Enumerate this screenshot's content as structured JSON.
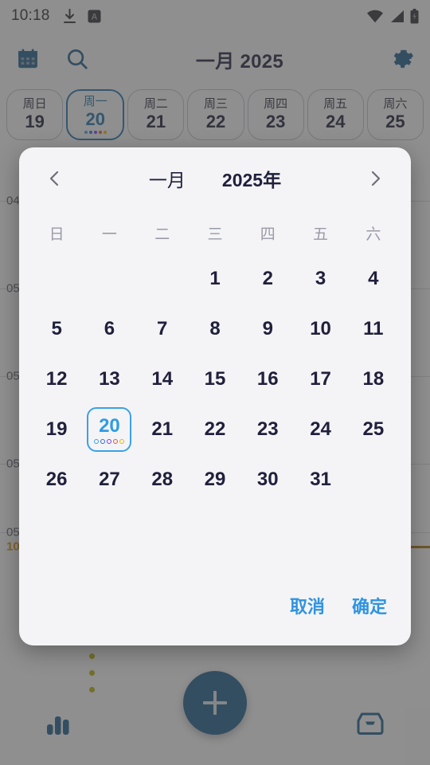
{
  "statusbar": {
    "time": "10:18",
    "icons_left": [
      "download-icon",
      "app-badge-a-icon"
    ],
    "icons_right": [
      "wifi-icon",
      "signal-icon",
      "battery-charging-icon"
    ]
  },
  "topbar": {
    "calendar_icon": "calendar-icon",
    "search_icon": "search-icon",
    "title": "一月 2025",
    "settings_icon": "gear-icon",
    "accent": "#1b5a86"
  },
  "weekstrip": {
    "days": [
      {
        "name": "周日",
        "num": "19",
        "selected": false
      },
      {
        "name": "周一",
        "num": "20",
        "selected": true
      },
      {
        "name": "周二",
        "num": "21",
        "selected": false
      },
      {
        "name": "周三",
        "num": "22",
        "selected": false
      },
      {
        "name": "周四",
        "num": "23",
        "selected": false
      },
      {
        "name": "周五",
        "num": "24",
        "selected": false
      },
      {
        "name": "周六",
        "num": "25",
        "selected": false
      }
    ],
    "selected_dots": [
      "#3aa0ea",
      "#2f6fe0",
      "#7b3fe4",
      "#e8503a",
      "#f0b400"
    ]
  },
  "timeline": {
    "labels": [
      "04:",
      "05:",
      "05:",
      "05:",
      "05:"
    ],
    "now_label": "10:",
    "now_color": "#d48806",
    "event_dot_color": "#b3a900"
  },
  "bottombar": {
    "left_icon": "bar-chart-icon",
    "fab_icon": "plus-icon",
    "right_icon": "inbox-icon"
  },
  "dialog": {
    "prev_icon": "chevron-left-icon",
    "next_icon": "chevron-right-icon",
    "month": "一月",
    "year": "2025年",
    "weekday_headers": [
      "日",
      "一",
      "二",
      "三",
      "四",
      "五",
      "六"
    ],
    "leading_blanks": 3,
    "days": [
      "1",
      "2",
      "3",
      "4",
      "5",
      "6",
      "7",
      "8",
      "9",
      "10",
      "11",
      "12",
      "13",
      "14",
      "15",
      "16",
      "17",
      "18",
      "19",
      "20",
      "21",
      "22",
      "23",
      "24",
      "25",
      "26",
      "27",
      "28",
      "29",
      "30",
      "31"
    ],
    "selected_day": "20",
    "selected_day_dots": [
      "#3aa0ea",
      "#2f6fe0",
      "#7b3fe4",
      "#e8503a",
      "#f0b400"
    ],
    "cancel_label": "取消",
    "confirm_label": "确定",
    "accent": "#2f93e0"
  }
}
